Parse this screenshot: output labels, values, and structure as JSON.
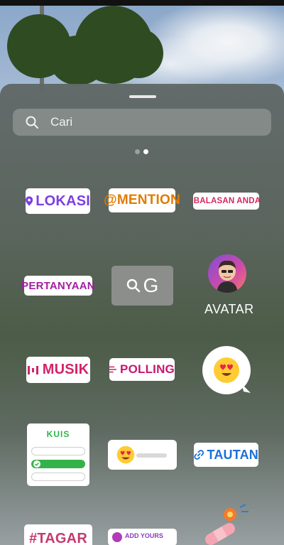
{
  "search": {
    "placeholder": "Cari"
  },
  "pager": {
    "pages": 2,
    "active": 2
  },
  "stickers": {
    "lokasi": "LOKASI",
    "mention": "@MENTION",
    "balasan": "BALASAN ANDA",
    "pertanyaan": "PERTANYAAN",
    "gif": "G",
    "avatar": "AVATAR",
    "musik": "MUSIK",
    "polling": "POLLING",
    "kuis": "KUIS",
    "tautan": "TAUTAN",
    "tagar": "#TAGAR",
    "partial": "ADD YOURS"
  },
  "colors": {
    "lokasi": "#7b3fe4",
    "mention": "#e07b00",
    "balasan": "#d3285f",
    "pertanyaan": "#a11fa1",
    "musik": "#d3226a",
    "polling": "#c5176f",
    "kuis": "#2fb34a",
    "tautan": "#1d6fd8",
    "tagar": "#c43b6d"
  }
}
